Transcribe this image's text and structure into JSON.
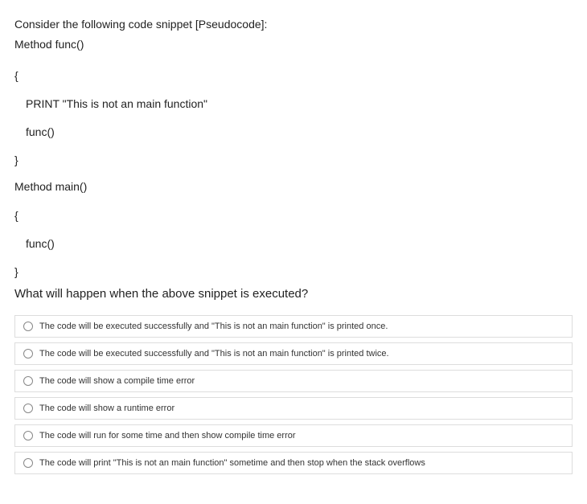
{
  "question": {
    "intro_line1": "Consider the following code snippet [Pseudocode]:",
    "intro_line2": "Method func()",
    "brace_open": "{",
    "line_print": "PRINT \"This is not an main function\"",
    "line_func_call_1": "func()",
    "brace_close": "}",
    "method_main": "Method main()",
    "brace_open_2": "{",
    "line_func_call_2": "func()",
    "brace_close_2": "}",
    "prompt": "What will happen when the above snippet is executed?"
  },
  "options": [
    "The code will be executed successfully and \"This is not an main function\" is printed once.",
    "The code will be executed successfully and \"This is not an main function\" is printed twice.",
    "The code will show a compile time error",
    "The code will show a runtime error",
    "The code will run for some time and then show compile time error",
    "The code will print \"This is not an main function\" sometime and then stop when the stack overflows"
  ]
}
